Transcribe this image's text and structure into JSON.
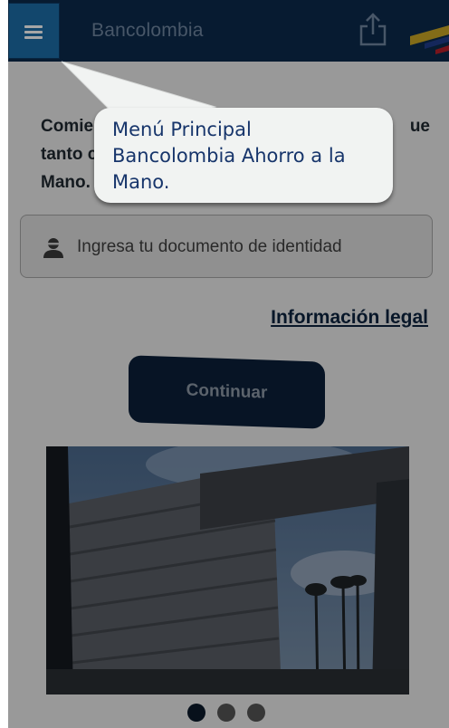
{
  "header": {
    "brand": "Bancolombia",
    "menu_icon": "hamburger-menu-icon",
    "share_icon": "share-icon",
    "logo": "bancolombia-flag-logo",
    "bg_color": "#0c2a4c",
    "accent_color": "#1d6ea8"
  },
  "intro": {
    "line1_left": "Comie",
    "line1_right": "ue",
    "line2": "tanto c",
    "line3": "Mano."
  },
  "document_field": {
    "placeholder": "Ingresa tu documento de identidad",
    "icon": "user-icon"
  },
  "legal_link": "Información legal",
  "continue_button": "Continuar",
  "carousel": {
    "slide_count": 3,
    "active_index": 0
  },
  "tooltip": {
    "line1": "Menú Principal",
    "line2": "Bancolombia  Ahorro a la",
    "line3": "Mano."
  }
}
